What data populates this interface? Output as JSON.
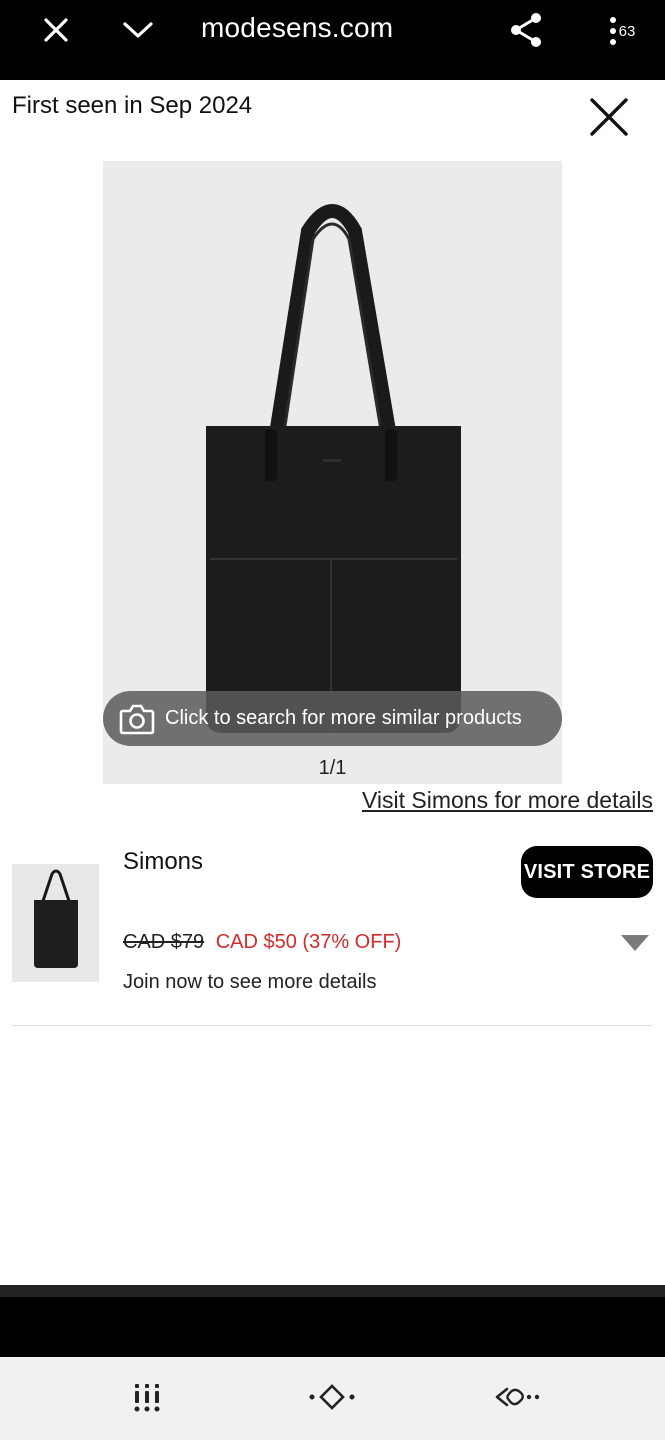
{
  "browser": {
    "url": "modesens.com",
    "tab_count": "63"
  },
  "header": {
    "first_seen": "First seen in Sep 2024"
  },
  "product_image": {
    "similar_search_label": "Click to search for more similar products",
    "pager": "1/1"
  },
  "visit_link": "Visit Simons for more details",
  "store": {
    "name": "Simons",
    "visit_button": "VISIT STORE",
    "old_price": "CAD $79",
    "new_price": "CAD $50 (37% OFF)",
    "join_text": "Join now to see more details"
  },
  "icons": {
    "close_tab": "close-icon",
    "collapse": "chevron-down-icon",
    "share": "share-icon",
    "tabs": "tabs-icon",
    "close_modal": "close-icon",
    "camera": "camera-icon",
    "expand": "triangle-down-icon",
    "nav_recent": "recent-apps-icon",
    "nav_home": "home-icon",
    "nav_back": "back-icon"
  },
  "colors": {
    "sale_red": "#d22b2b",
    "button_black": "#000000",
    "image_bg": "#ebebeb"
  }
}
